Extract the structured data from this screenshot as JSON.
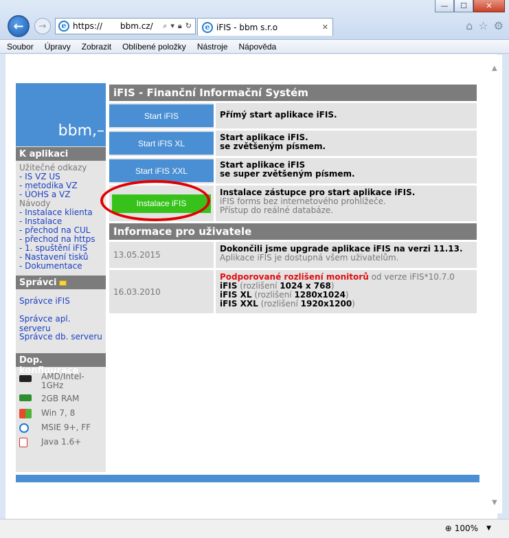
{
  "browser": {
    "url": "https://",
    "host": "bbm.cz/",
    "tab_title": "iFIS - bbm s.r.o",
    "zoom": "100%",
    "window_buttons": {
      "minimize": "—",
      "maximize": "☐",
      "close": "✕"
    },
    "menu": [
      "Soubor",
      "Úpravy",
      "Zobrazit",
      "Oblíbené položky",
      "Nástroje",
      "Nápověda"
    ]
  },
  "sidebar": {
    "logo": "bbm,–",
    "k_aplikaci_heading": "K aplikaci",
    "uzitecne_label": "Užitečné odkazy",
    "uzitecne_links": [
      "- IS VZ US",
      "- metodika VZ",
      "- ÚOHS a VZ"
    ],
    "navody_label": "Návody",
    "navody_links": [
      "- Instalace klienta",
      "- Instalace",
      "- přechod na CUL",
      "- přechod na https",
      "- 1. spuštění iFIS",
      "- Nastavení tisků",
      "- Dokumentace"
    ],
    "spravci_heading": "Správci",
    "spravci_links": [
      "Správce iFIS",
      "Správce apl. serveru",
      "Správce db. serveru"
    ],
    "conf_heading": "Dop. konfigurace",
    "conf_items": [
      {
        "icon": "cpu-icon",
        "text": "AMD/Intel-1GHz"
      },
      {
        "icon": "ram-icon",
        "text": "2GB RAM"
      },
      {
        "icon": "windows-icon",
        "text": "Win 7, 8"
      },
      {
        "icon": "ie-icon",
        "text": "MSIE 9+, FF"
      },
      {
        "icon": "java-icon",
        "text": "Java 1.6+"
      }
    ]
  },
  "main": {
    "heading": "iFIS - Finanční Informační Systém",
    "apps": [
      {
        "button": "Start iFIS",
        "line1": "Přímý start aplikace iFIS.",
        "line2": "",
        "line3": ""
      },
      {
        "button": "Start iFIS XL",
        "line1": "Start aplikace iFIS.",
        "line2": "se zvětšeným písmem.",
        "line3": ""
      },
      {
        "button": "Start iFIS XXL",
        "line1": "Start aplikace iFIS",
        "line2": "se super zvětšeným písmem.",
        "line3": ""
      },
      {
        "button": "Instalace iFIS",
        "line1": "Instalace zástupce pro start aplikace iFIS.",
        "line2": "iFIS forms bez internetového prohlížeče.",
        "line3": "Přístup do reálné databáze."
      }
    ],
    "info_heading": "Informace pro uživatele",
    "info": [
      {
        "date": "13.05.2015",
        "title": "Dokončili jsme upgrade aplikace iFIS na verzi 11.13.",
        "sub": "Aplikace iFIS je dostupná všem uživatelům."
      },
      {
        "date": "16.03.2010",
        "title_red": "Podporované rozlišení monitorů",
        "title_rest": " od verze iFIS*10.7.0",
        "res": [
          {
            "name": "iFIS",
            "label": " (rozlišení ",
            "value": "1024 x 768",
            "end": ")"
          },
          {
            "name": "iFIS XL",
            "label": " (rozlišení ",
            "value": "1280x1024",
            "end": ")"
          },
          {
            "name": "iFIS XXL",
            "label": " (rozlišení ",
            "value": "1920x1200",
            "end": ")"
          }
        ]
      }
    ]
  },
  "colors": {
    "accent_blue": "#4a8fd3",
    "install_green": "#36c21a",
    "highlight_red": "#e00000",
    "heading_grey": "#7c7c7c"
  }
}
